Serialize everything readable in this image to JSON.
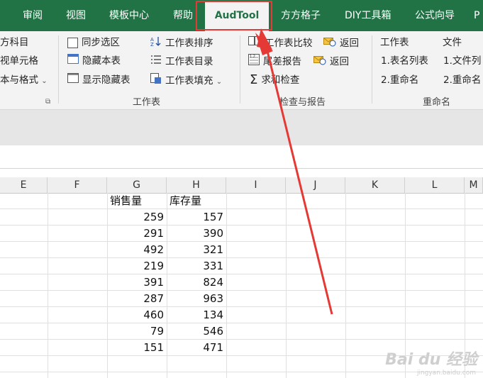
{
  "tabs": [
    {
      "label": "审阅"
    },
    {
      "label": "视图"
    },
    {
      "label": "模板中心"
    },
    {
      "label": "帮助"
    },
    {
      "label": "AudTool"
    },
    {
      "label": "方方格子"
    },
    {
      "label": "DIY工具箱"
    },
    {
      "label": "公式向导"
    },
    {
      "label": "P"
    }
  ],
  "ribbon": {
    "left_col": [
      "方科目",
      "视单元格",
      "本与格式"
    ],
    "sheet_group": {
      "sync_select": "同步选区",
      "hide_this": "隐藏本表",
      "show_hidden": "显示隐藏表",
      "sort": "工作表排序",
      "toc": "工作表目录",
      "fill": "工作表填充",
      "label": "工作表"
    },
    "check_group": {
      "compare": "工作表比较",
      "diff_report": "尾差报告",
      "sum_check": "求和检查",
      "back1": "返回",
      "back2": "返回",
      "label": "检查与报告"
    },
    "rename_group": {
      "sheet_header": "工作表",
      "sheet_list": "1.表名列表",
      "sheet_rename": "2.重命名",
      "file_header": "文件",
      "file_list": "1.文件列",
      "file_rename": "2.重命名",
      "label": "重命名"
    }
  },
  "columns": [
    "E",
    "F",
    "G",
    "H",
    "I",
    "J",
    "K",
    "L",
    "M"
  ],
  "table": {
    "headers": [
      "销售量",
      "库存量"
    ],
    "rows": [
      [
        "259",
        "157"
      ],
      [
        "291",
        "390"
      ],
      [
        "492",
        "321"
      ],
      [
        "219",
        "331"
      ],
      [
        "391",
        "824"
      ],
      [
        "287",
        "963"
      ],
      [
        "460",
        "134"
      ],
      [
        "79",
        "546"
      ],
      [
        "151",
        "471"
      ]
    ]
  },
  "watermark": {
    "brand": "Bai du 经验",
    "url": "jingyan.baidu.com"
  },
  "colors": {
    "tab_bg": "#217346",
    "ribbon_bg": "#f3f3f3",
    "highlight": "#e53935"
  }
}
